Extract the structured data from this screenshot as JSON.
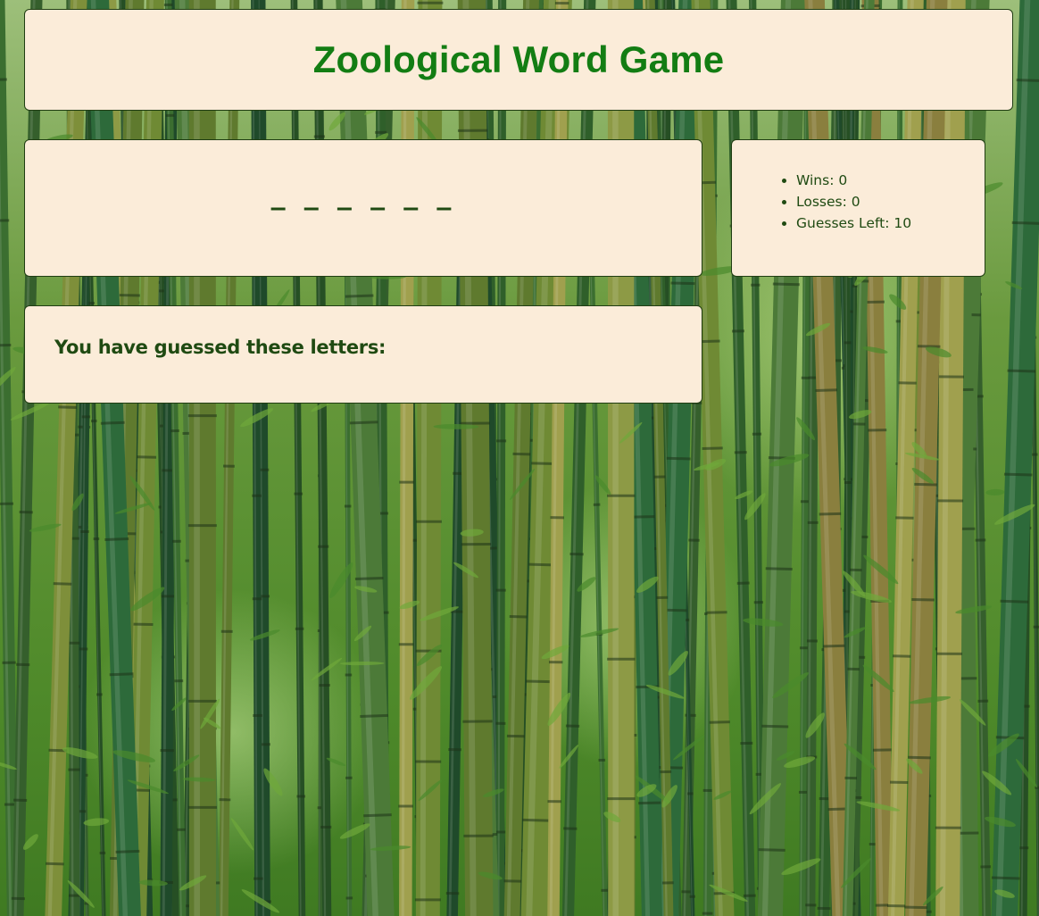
{
  "title": "Zoological Word Game",
  "word_display": "______",
  "stats": {
    "wins_label": "Wins: 0",
    "losses_label": "Losses: 0",
    "guesses_left_label": "Guesses Left: 10"
  },
  "guessed": {
    "heading": "You have guessed these letters:",
    "letters": ""
  },
  "colors": {
    "panel_background": "#fbecd9",
    "title_green": "#137d13",
    "text_green": "#1f4a12",
    "panel_border": "#1f3d12"
  },
  "background_image": "bamboo-forest"
}
